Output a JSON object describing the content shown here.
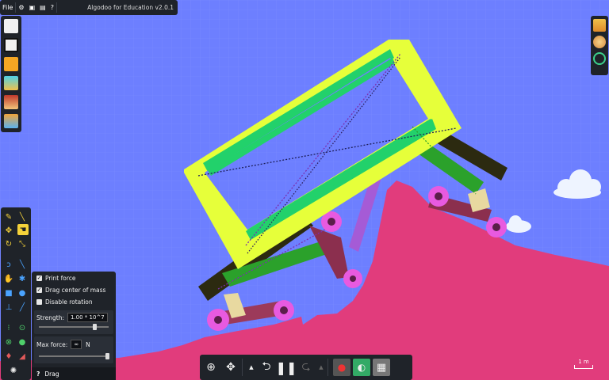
{
  "app": {
    "title": "Algodoo for Education v2.0.1",
    "menu_file": "File"
  },
  "topbar_icons": [
    "gear-icon",
    "window-icon",
    "screen-icon",
    "help-icon"
  ],
  "left_toolbar_icons": [
    "new-scene-icon",
    "open-scene-icon",
    "folder-icon",
    "phunlets-icon",
    "character-icon",
    "scenes-icon"
  ],
  "right_toolbar_icons": [
    "layers-icon",
    "palette-icon",
    "zoom-reset-icon"
  ],
  "options_panel": {
    "print_force": "Print force",
    "drag_center_of_mass": "Drag center of mass",
    "disable_rotation": "Disable rotation",
    "strength_label": "Strength:",
    "strength_value": "1.00 * 10^7",
    "max_force_label": "Max force:",
    "max_force_value": "∞",
    "max_force_unit": "N",
    "help_label": "Drag",
    "print_force_checked": true,
    "drag_center_of_mass_checked": true,
    "disable_rotation_checked": false,
    "strength_level": 0.8
  },
  "bottom_toolbar": {
    "icons": [
      "zoom-icon",
      "move-icon",
      "up-arrow-icon",
      "undo-icon",
      "pause-icon",
      "redo-icon",
      "up-arrow-icon",
      "record-icon",
      "speed-icon",
      "grid-icon"
    ]
  },
  "scale_label": "1 m",
  "colors": {
    "sky": "#6d7fff",
    "ground": "#e13c7c",
    "frame": "#e6ff3a",
    "accent_green": "#22d16b",
    "wheel": "#e85ae0",
    "cloud": "#eef4ff"
  }
}
